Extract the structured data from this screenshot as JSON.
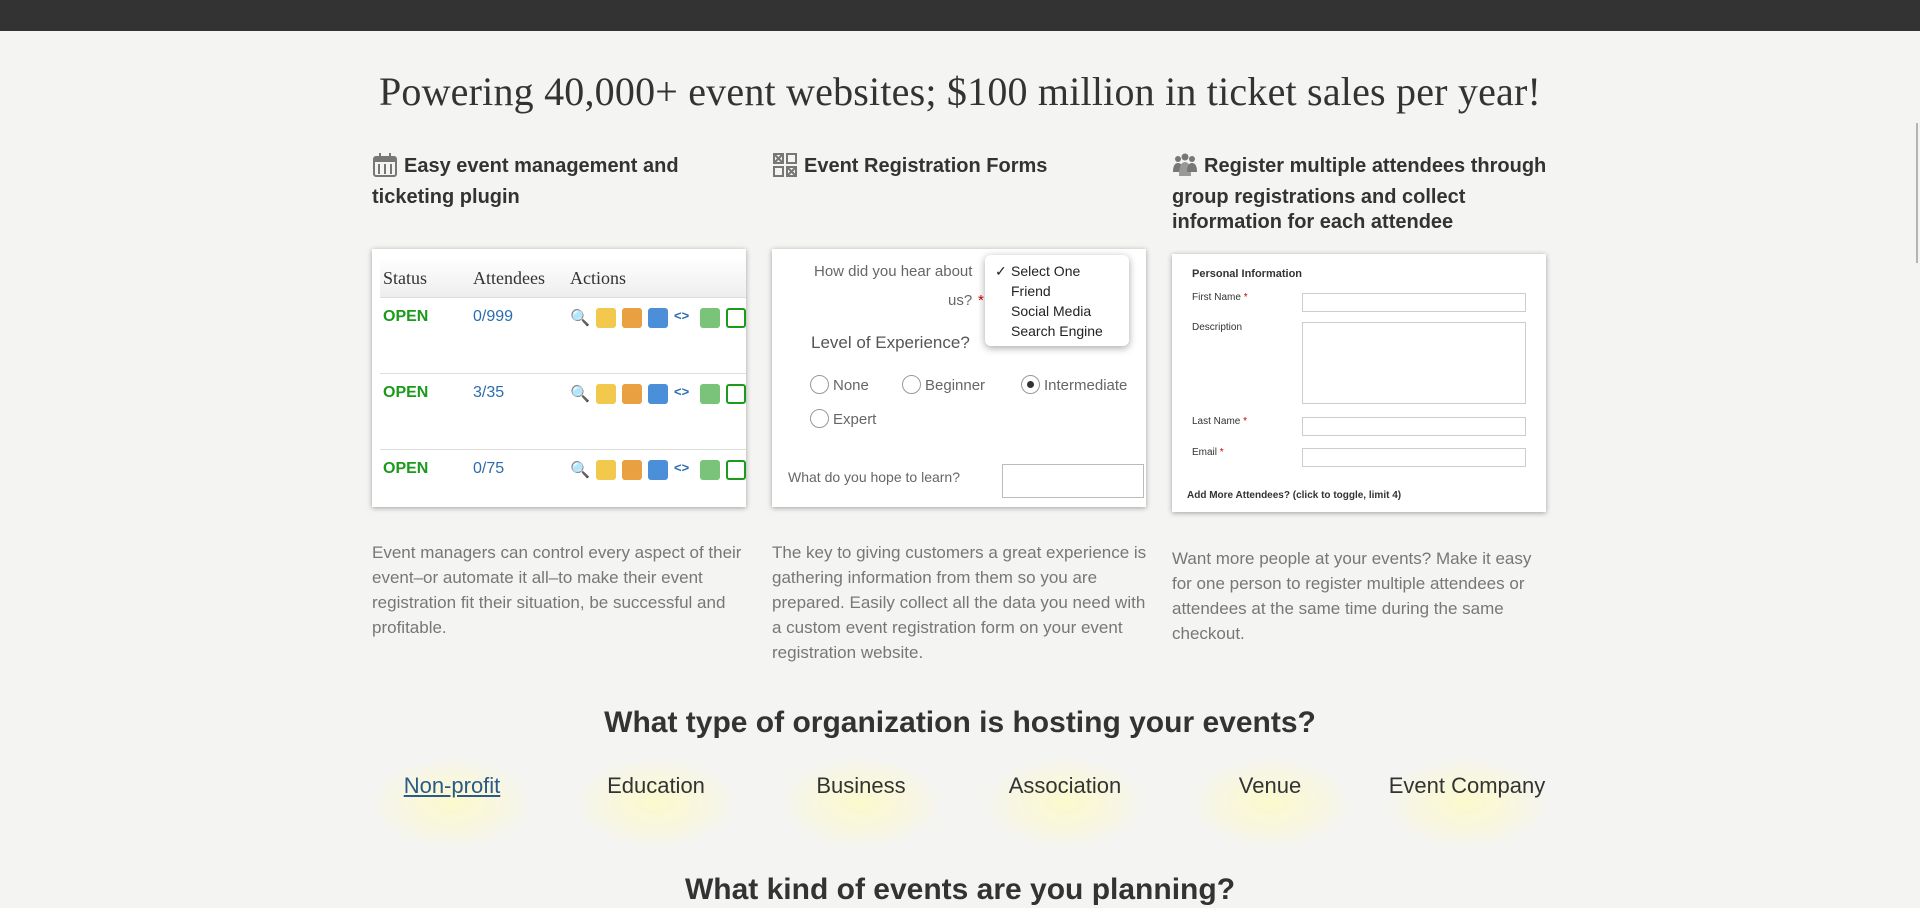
{
  "headline": "Powering 40,000+ event websites; $100 million in ticket sales per year!",
  "features": [
    {
      "title": "Easy event management and ticketing plugin",
      "icon": "calendar-icon",
      "description": "Event managers can control every aspect of their event–or automate it all–to make their event registration fit their situation, be successful and profitable."
    },
    {
      "title": "Event Registration Forms",
      "icon": "form-grid-icon",
      "description": "The key to giving customers a great experience is gathering information from them so you are prepared. Easily collect all the data you need with a custom event registration form on your event registration website."
    },
    {
      "title": "Register multiple attendees through group registrations and collect information for each attendee",
      "icon": "group-icon",
      "description": "Want more people at your events? Make it easy for one person to register multiple attendees or attendees at the same time during the same checkout."
    }
  ],
  "events_table": {
    "headers": [
      "Status",
      "Attendees",
      "Actions"
    ],
    "rows": [
      {
        "status": "OPEN",
        "attendees": "0/999"
      },
      {
        "status": "OPEN",
        "attendees": "3/35"
      },
      {
        "status": "OPEN",
        "attendees": "0/75"
      }
    ]
  },
  "reg_form": {
    "question1": "How did you hear about",
    "question1_cont": "us?",
    "dropdown_options": [
      "Select One",
      "Friend",
      "Social Media",
      "Search Engine"
    ],
    "level_label": "Level of Experience?",
    "levels": [
      "None",
      "Beginner",
      "Intermediate",
      "Expert"
    ],
    "selected_level": "Intermediate",
    "learn_label": "What do you hope to learn?"
  },
  "attendee_form": {
    "section": "Personal Information",
    "first_name": "First Name",
    "description": "Description",
    "last_name": "Last Name",
    "email": "Email",
    "add_more": "Add More Attendees? (click to toggle, limit 4)"
  },
  "org_section": {
    "title": "What type of organization is hosting your events?",
    "options": [
      "Non-profit",
      "Education",
      "Business",
      "Association",
      "Venue",
      "Event Company"
    ]
  },
  "plan_title": "What kind of events are you planning?",
  "colors": {
    "open_status": "#1a9b1a",
    "link": "#2b5a8a",
    "topbar": "#333333"
  }
}
